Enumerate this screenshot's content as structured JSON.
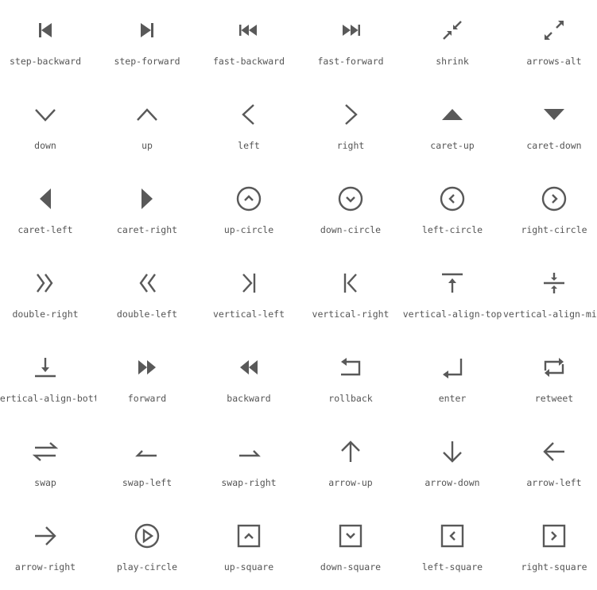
{
  "icon_color": "#595959",
  "icons": [
    {
      "label": "step-backward",
      "icon": "step-backward-icon"
    },
    {
      "label": "step-forward",
      "icon": "step-forward-icon"
    },
    {
      "label": "fast-backward",
      "icon": "fast-backward-icon"
    },
    {
      "label": "fast-forward",
      "icon": "fast-forward-icon"
    },
    {
      "label": "shrink",
      "icon": "shrink-icon"
    },
    {
      "label": "arrows-alt",
      "icon": "arrows-alt-icon"
    },
    {
      "label": "down",
      "icon": "down-icon"
    },
    {
      "label": "up",
      "icon": "up-icon"
    },
    {
      "label": "left",
      "icon": "left-icon"
    },
    {
      "label": "right",
      "icon": "right-icon"
    },
    {
      "label": "caret-up",
      "icon": "caret-up-icon"
    },
    {
      "label": "caret-down",
      "icon": "caret-down-icon"
    },
    {
      "label": "caret-left",
      "icon": "caret-left-icon"
    },
    {
      "label": "caret-right",
      "icon": "caret-right-icon"
    },
    {
      "label": "up-circle",
      "icon": "up-circle-icon"
    },
    {
      "label": "down-circle",
      "icon": "down-circle-icon"
    },
    {
      "label": "left-circle",
      "icon": "left-circle-icon"
    },
    {
      "label": "right-circle",
      "icon": "right-circle-icon"
    },
    {
      "label": "double-right",
      "icon": "double-right-icon"
    },
    {
      "label": "double-left",
      "icon": "double-left-icon"
    },
    {
      "label": "vertical-left",
      "icon": "vertical-left-icon"
    },
    {
      "label": "vertical-right",
      "icon": "vertical-right-icon"
    },
    {
      "label": "vertical-align-top",
      "icon": "vertical-align-top-icon"
    },
    {
      "label": "vertical-align-middle",
      "icon": "vertical-align-middle-icon"
    },
    {
      "label": "vertical-align-bottom",
      "icon": "vertical-align-bottom-icon"
    },
    {
      "label": "forward",
      "icon": "forward-icon"
    },
    {
      "label": "backward",
      "icon": "backward-icon"
    },
    {
      "label": "rollback",
      "icon": "rollback-icon"
    },
    {
      "label": "enter",
      "icon": "enter-icon"
    },
    {
      "label": "retweet",
      "icon": "retweet-icon"
    },
    {
      "label": "swap",
      "icon": "swap-icon"
    },
    {
      "label": "swap-left",
      "icon": "swap-left-icon"
    },
    {
      "label": "swap-right",
      "icon": "swap-right-icon"
    },
    {
      "label": "arrow-up",
      "icon": "arrow-up-icon"
    },
    {
      "label": "arrow-down",
      "icon": "arrow-down-icon"
    },
    {
      "label": "arrow-left",
      "icon": "arrow-left-icon"
    },
    {
      "label": "arrow-right",
      "icon": "arrow-right-icon"
    },
    {
      "label": "play-circle",
      "icon": "play-circle-icon"
    },
    {
      "label": "up-square",
      "icon": "up-square-icon"
    },
    {
      "label": "down-square",
      "icon": "down-square-icon"
    },
    {
      "label": "left-square",
      "icon": "left-square-icon"
    },
    {
      "label": "right-square",
      "icon": "right-square-icon"
    }
  ]
}
